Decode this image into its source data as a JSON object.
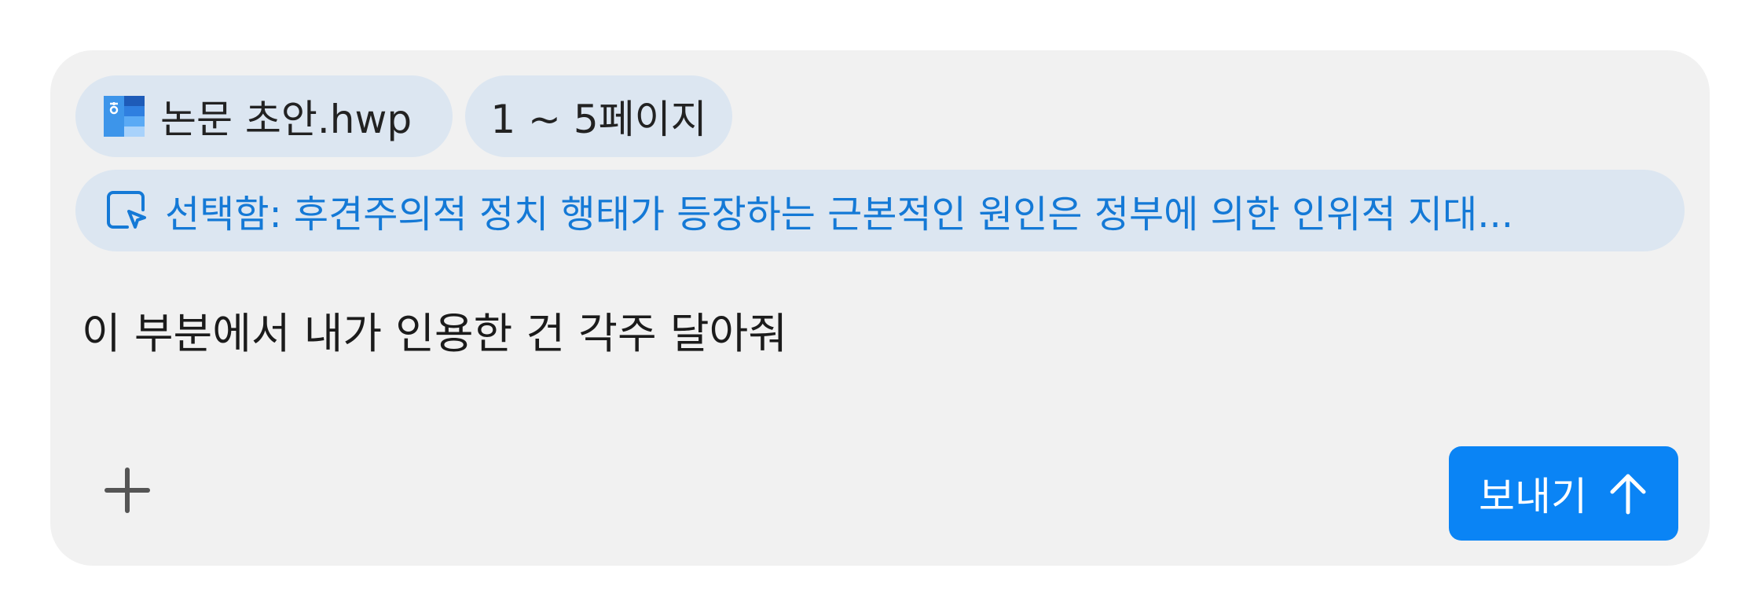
{
  "attachments": {
    "file": {
      "name": "논문 초안.hwp",
      "icon": "hwp-document-icon"
    },
    "pages": {
      "label": "1 ~ 5페이지"
    }
  },
  "selection": {
    "icon": "cursor-select-icon",
    "text": "선택함: 후견주의적 정치 행태가 등장하는 근본적인 원인은 정부에 의한 인위적 지대..."
  },
  "message": {
    "text": "이 부분에서 내가 인용한 건 각주 달아줘"
  },
  "toolbar": {
    "add_icon": "plus-icon",
    "send_label": "보내기",
    "send_icon": "arrow-up-icon"
  },
  "colors": {
    "composer_bg": "#f1f1f1",
    "chip_bg": "#dce6f1",
    "selection_text": "#1479d6",
    "send_button": "#0a84f5"
  }
}
